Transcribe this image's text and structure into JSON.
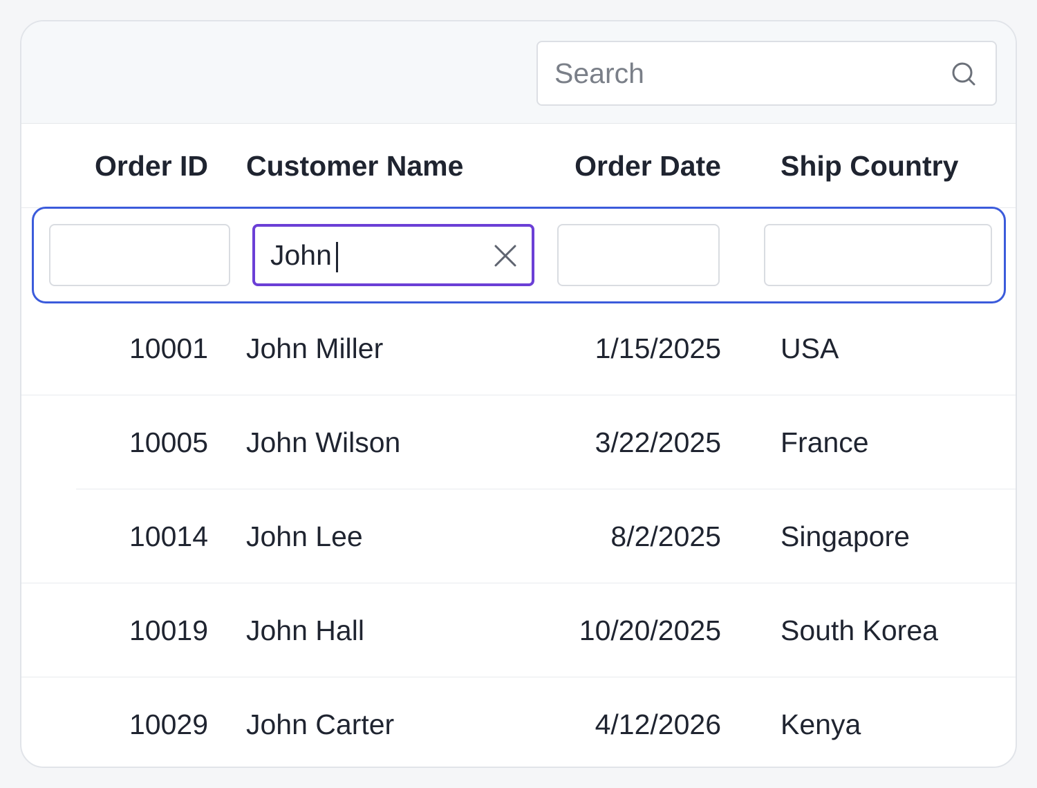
{
  "search": {
    "placeholder": "Search",
    "value": ""
  },
  "columns": [
    {
      "label": "Order ID"
    },
    {
      "label": "Customer Name"
    },
    {
      "label": "Order Date"
    },
    {
      "label": "Ship Country"
    }
  ],
  "filters": {
    "order_id": "",
    "customer_name": "John",
    "order_date": "",
    "ship_country": ""
  },
  "rows": [
    {
      "order_id": "10001",
      "customer_name": "John Miller",
      "order_date": "1/15/2025",
      "ship_country": "USA"
    },
    {
      "order_id": "10005",
      "customer_name": "John Wilson",
      "order_date": "3/22/2025",
      "ship_country": "France"
    },
    {
      "order_id": "10014",
      "customer_name": "John Lee",
      "order_date": "8/2/2025",
      "ship_country": "Singapore"
    },
    {
      "order_id": "10019",
      "customer_name": "John Hall",
      "order_date": "10/20/2025",
      "ship_country": "South Korea"
    },
    {
      "order_id": "10029",
      "customer_name": "John Carter",
      "order_date": "4/12/2026",
      "ship_country": "Kenya"
    }
  ],
  "colors": {
    "filter_row_outline": "#3b5bdb",
    "active_filter_border": "#6b3fd6",
    "toolbar_bg": "#f6f8fa"
  },
  "icons": {
    "search": "search-icon",
    "clear": "close-icon"
  }
}
